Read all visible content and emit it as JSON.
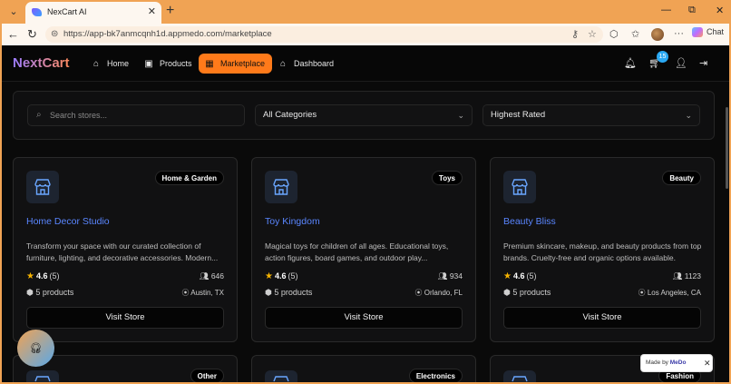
{
  "browser": {
    "tab_title": "NexCart AI",
    "url": "https://app-bk7anmcqnh1d.appmedo.com/marketplace",
    "chat_label": "Chat",
    "minimize": "—",
    "restore": "⧉",
    "close": "✕"
  },
  "app": {
    "logo": "NextCart",
    "nav": [
      {
        "label": "Home",
        "icon": "home-icon"
      },
      {
        "label": "Products",
        "icon": "bag-icon"
      },
      {
        "label": "Marketplace",
        "icon": "store-icon",
        "active": true
      },
      {
        "label": "Dashboard",
        "icon": "home-icon"
      }
    ],
    "cart_count": "15"
  },
  "filters": {
    "search_placeholder": "Search stores...",
    "category": "All Categories",
    "sort": "Highest Rated"
  },
  "stores": [
    {
      "name": "Home Decor Studio",
      "category": "Home & Garden",
      "description": "Transform your space with our curated collection of furniture, lighting, and decorative accessories. Modern...",
      "rating": "4.6",
      "reviews": "(5)",
      "followers": "646",
      "products": "5 products",
      "location": "Austin, TX",
      "button": "Visit Store"
    },
    {
      "name": "Toy Kingdom",
      "category": "Toys",
      "description": "Magical toys for children of all ages. Educational toys, action figures, board games, and outdoor play...",
      "rating": "4.6",
      "reviews": "(5)",
      "followers": "934",
      "products": "5 products",
      "location": "Orlando, FL",
      "button": "Visit Store"
    },
    {
      "name": "Beauty Bliss",
      "category": "Beauty",
      "description": "Premium skincare, makeup, and beauty products from top brands. Cruelty-free and organic options available.",
      "rating": "4.6",
      "reviews": "(5)",
      "followers": "1123",
      "products": "5 products",
      "location": "Los Angeles, CA",
      "button": "Visit Store"
    }
  ],
  "next_row_categories": [
    "Other",
    "Electronics",
    "Fashion"
  ],
  "made_by": {
    "prefix": "Made by",
    "brand": "MeDo"
  },
  "colors": {
    "accent": "#ff7a1a",
    "link": "#5a86ff",
    "badge": "#2aa8f2",
    "chrome": "#f0a354"
  }
}
